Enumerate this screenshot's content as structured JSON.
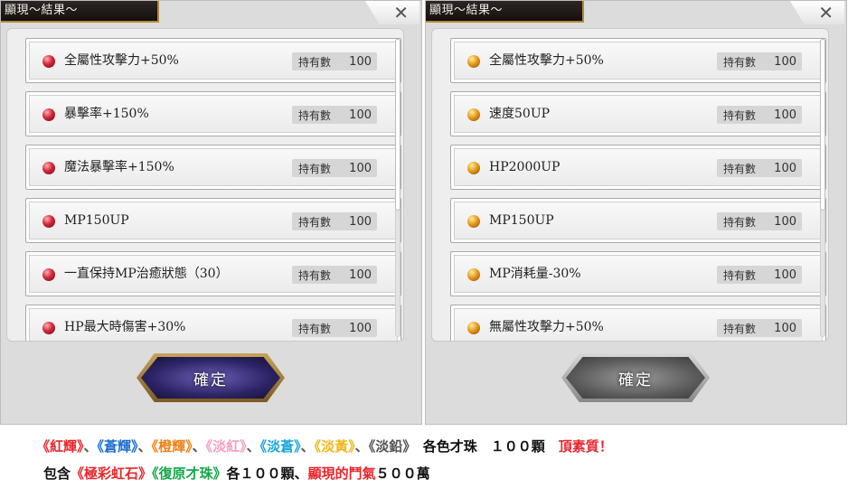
{
  "panels": [
    {
      "title": "顯現～結果～",
      "close_label": "✕",
      "gem_color": "red",
      "ok_label": "確定",
      "ok_style": "purple",
      "items": [
        {
          "label": "全屬性攻擊力+50%",
          "hold_label": "持有數",
          "count": "100"
        },
        {
          "label": "暴擊率+150%",
          "hold_label": "持有數",
          "count": "100"
        },
        {
          "label": "魔法暴擊率+150%",
          "hold_label": "持有數",
          "count": "100"
        },
        {
          "label": "MP150UP",
          "hold_label": "持有數",
          "count": "100"
        },
        {
          "label": "一直保持MP治癒狀態（30）",
          "hold_label": "持有數",
          "count": "100"
        },
        {
          "label": "HP最大時傷害+30%",
          "hold_label": "持有數",
          "count": "100"
        }
      ]
    },
    {
      "title": "顯現～結果～",
      "close_label": "✕",
      "gem_color": "orange",
      "ok_label": "確定",
      "ok_style": "gray",
      "items": [
        {
          "label": "全屬性攻擊力+50%",
          "hold_label": "持有數",
          "count": "100"
        },
        {
          "label": "速度50UP",
          "hold_label": "持有數",
          "count": "100"
        },
        {
          "label": "HP2000UP",
          "hold_label": "持有數",
          "count": "100"
        },
        {
          "label": "MP150UP",
          "hold_label": "持有數",
          "count": "100"
        },
        {
          "label": "MP消耗量-30%",
          "hold_label": "持有數",
          "count": "100"
        },
        {
          "label": "無屬性攻擊力+50%",
          "hold_label": "持有數",
          "count": "100"
        }
      ]
    }
  ],
  "footer": {
    "line1": {
      "red": "《紅輝》",
      "sep1": "、",
      "blue": "《蒼輝》",
      "sep2": "、",
      "orange": "《橙輝》",
      "sep3": "、",
      "pink": "《淡紅》",
      "sep4": "、",
      "cyan": "《淡蒼》",
      "sep5": "、",
      "yellow": "《淡黃》",
      "sep6": "、",
      "gray": "《淡鉛》",
      "suffix": "各色才珠　１００顆",
      "highlight": "頂素質！"
    },
    "line2": {
      "prefix": "包含",
      "rainbow": "《極彩虹石》",
      "restore": "《復原才珠》",
      "mid": "各１００顆、",
      "manifest": "顯現的鬥氣",
      "suffix": "５００萬"
    }
  },
  "colors": {
    "red": "#e8262b",
    "blue": "#1a6fd1",
    "orange": "#f07f14",
    "pink": "#f3a0bb",
    "cyan": "#18a5e0",
    "yellow": "#f0b71a",
    "green": "#15a84a"
  }
}
